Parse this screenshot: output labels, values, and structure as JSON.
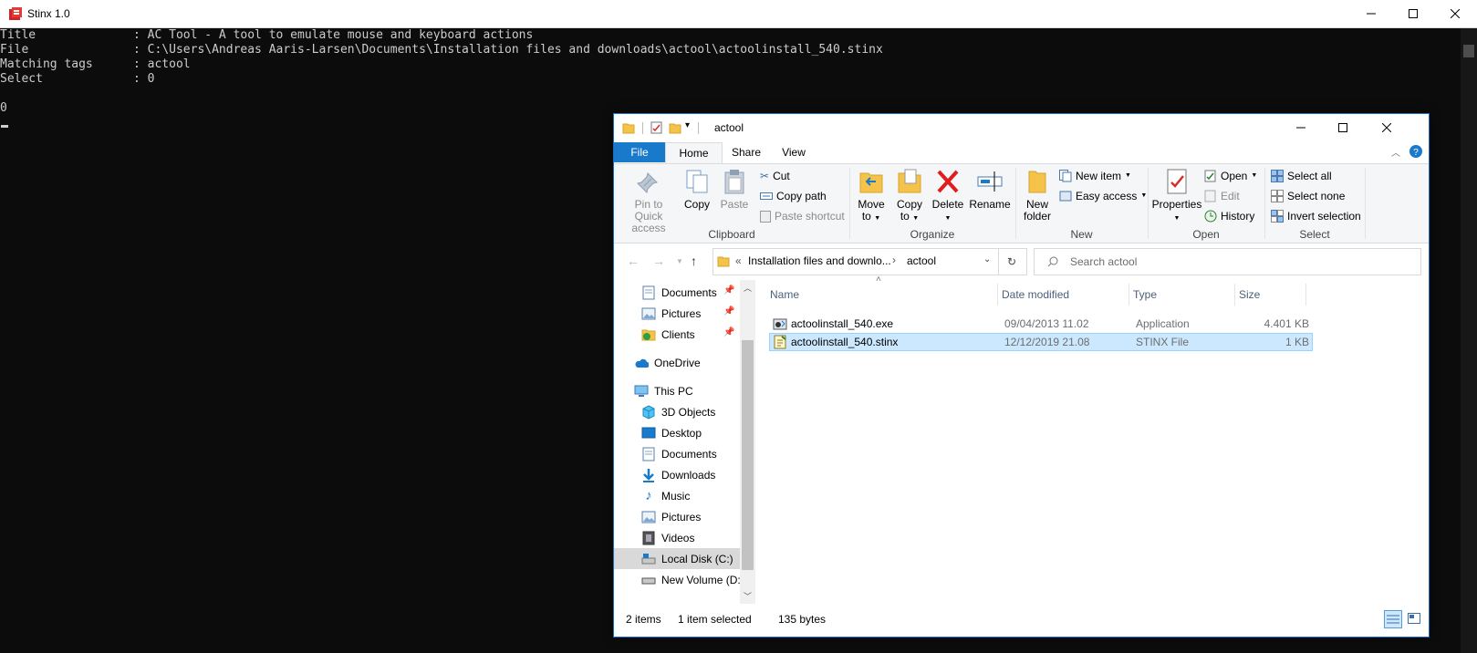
{
  "console_window": {
    "title": "Stinx 1.0",
    "lines": [
      {
        "key": "Title",
        "value": ": AC Tool - A tool to emulate mouse and keyboard actions"
      },
      {
        "key": "File",
        "value": ": C:\\Users\\Andreas Aaris-Larsen\\Documents\\Installation files and downloads\\actool\\actoolinstall_540.stinx"
      },
      {
        "key": "Matching tags",
        "value": ": actool"
      },
      {
        "key": "Select",
        "value": ": 0"
      }
    ],
    "output": "0"
  },
  "explorer": {
    "title": "actool",
    "tabs": {
      "file": "File",
      "home": "Home",
      "share": "Share",
      "view": "View"
    },
    "ribbon": {
      "clipboard": {
        "label": "Clipboard",
        "pin_line1": "Pin to Quick",
        "pin_line2": "access",
        "copy": "Copy",
        "paste": "Paste",
        "cut": "Cut",
        "copy_path": "Copy path",
        "paste_shortcut": "Paste shortcut"
      },
      "organize": {
        "label": "Organize",
        "move_line1": "Move",
        "move_line2": "to",
        "copy_line1": "Copy",
        "copy_line2": "to",
        "delete": "Delete",
        "rename": "Rename"
      },
      "new": {
        "label": "New",
        "new_folder_line1": "New",
        "new_folder_line2": "folder",
        "new_item": "New item",
        "easy_access": "Easy access"
      },
      "open": {
        "label": "Open",
        "properties": "Properties",
        "open": "Open",
        "edit": "Edit",
        "history": "History"
      },
      "select": {
        "label": "Select",
        "select_all": "Select all",
        "select_none": "Select none",
        "invert_selection": "Invert selection"
      }
    },
    "address": {
      "prefix": "«",
      "crumb1": "Installation files and downlo...",
      "sep": "›",
      "crumb2": "actool"
    },
    "search_placeholder": "Search actool",
    "nav": {
      "documents_pinned": "Documents",
      "pictures_pinned": "Pictures",
      "clients": "Clients",
      "onedrive": "OneDrive",
      "this_pc": "This PC",
      "objects3d": "3D Objects",
      "desktop": "Desktop",
      "documents": "Documents",
      "downloads": "Downloads",
      "music": "Music",
      "pictures": "Pictures",
      "videos": "Videos",
      "local_disk": "Local Disk (C:)",
      "new_volume": "New Volume (D:"
    },
    "columns": {
      "name": "Name",
      "date": "Date modified",
      "type": "Type",
      "size": "Size"
    },
    "files": [
      {
        "name": "actoolinstall_540.exe",
        "date": "09/04/2013 11.02",
        "type": "Application",
        "size": "4.401 KB"
      },
      {
        "name": "actoolinstall_540.stinx",
        "date": "12/12/2019 21.08",
        "type": "STINX File",
        "size": "1 KB"
      }
    ],
    "status": {
      "items": "2 items",
      "selected": "1 item selected",
      "bytes": "135 bytes"
    }
  }
}
